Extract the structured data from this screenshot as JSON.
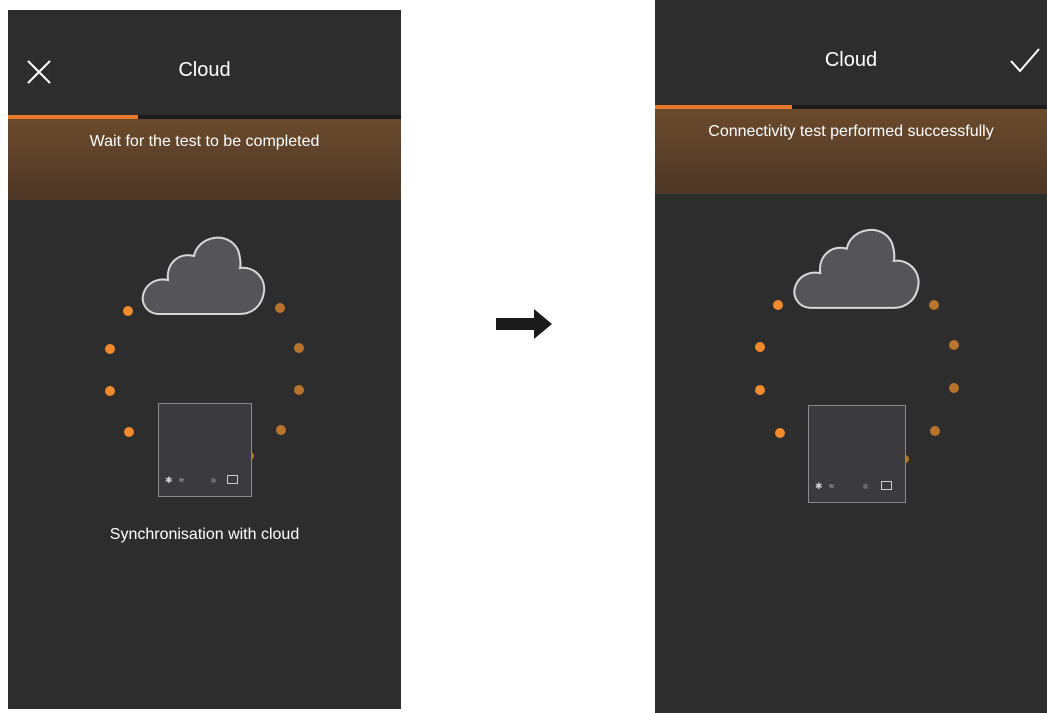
{
  "left": {
    "title": "Cloud",
    "banner": "Wait for the test to be completed",
    "subtitle": "Synchronisation with cloud",
    "progress": 0.33
  },
  "right": {
    "title": "Cloud",
    "banner": "Connectivity test performed successfully",
    "progress": 0.35
  },
  "colors": {
    "accent": "#e8782a",
    "background": "#2d2d2e",
    "banner": "#5a3f28"
  },
  "icons": {
    "close": "close-icon",
    "confirm": "checkmark-icon",
    "cloud": "cloud-icon",
    "transition": "arrow-right-icon"
  }
}
